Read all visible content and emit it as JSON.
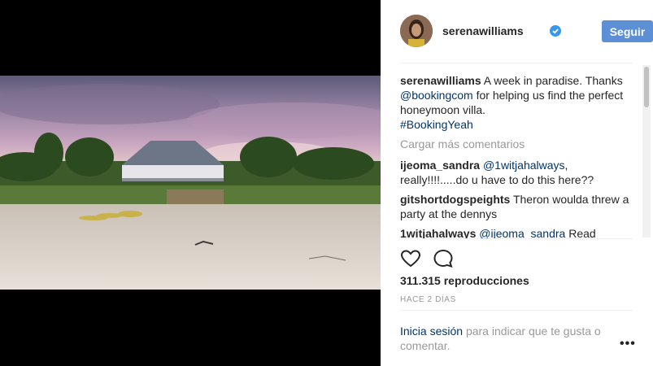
{
  "post": {
    "username": "serenawilliams",
    "follow_label": "Seguir",
    "caption_user": "serenawilliams",
    "caption_text_1": "A week in paradise. Thanks",
    "caption_mention": "@bookingcom",
    "caption_text_2": "for helping us find the perfect honeymoon villa.",
    "caption_hashtag": "#BookingYeah",
    "load_more": "Cargar más comentarios",
    "comments": [
      {
        "user": "ijeoma_sandra",
        "mention": "@1witjahalways",
        "text": ", really!!!!.....do u have to do this here??"
      },
      {
        "user": "gitshortdogspeights",
        "mention": "",
        "text": "Theron woulda threw a party at the dennys"
      },
      {
        "user": "1witjahalways",
        "mention": "@ijeoma_sandra",
        "text": "Read"
      }
    ],
    "views": "311.315 reproducciones",
    "time": "HACE 2 DÍAS",
    "login_link": "Inicia sesión",
    "login_text": "para indicar que te gusta o comentar.",
    "more_options": "•••"
  },
  "icons": {
    "verified": "verified-badge-icon",
    "like": "heart-icon",
    "comment": "comment-bubble-icon",
    "more": "more-options-icon"
  },
  "colors": {
    "follow_button": "#5c8fd6",
    "link": "#003569",
    "verified": "#3897f0"
  }
}
